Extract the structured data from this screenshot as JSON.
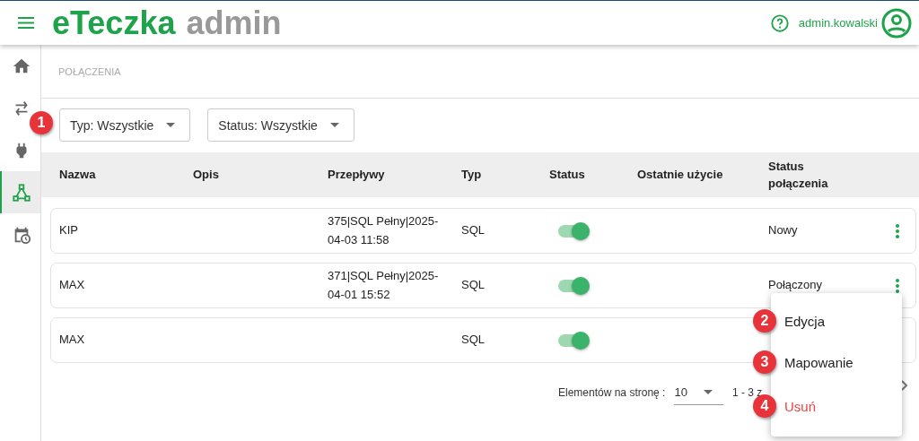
{
  "header": {
    "logo_primary": "eTeczka",
    "logo_secondary": "admin",
    "username": "admin.kowalski"
  },
  "sidebar": [
    {
      "selected": false
    },
    {
      "selected": false
    },
    {
      "selected": false
    },
    {
      "selected": true
    },
    {
      "selected": false
    }
  ],
  "breadcrumb": "POŁĄCZENIA",
  "filters": [
    {
      "label": "Typ: Wszystkie",
      "badge": "1"
    },
    {
      "label": "Status: Wszystkie"
    }
  ],
  "table": {
    "columns": [
      "Nazwa",
      "Opis",
      "Przepływy",
      "Typ",
      "Status",
      "Ostatnie użycie",
      "Status połączenia"
    ],
    "rows": [
      {
        "name": "KIP",
        "flows": "375|SQL Pełny|2025-04-03 11:58",
        "type": "SQL",
        "enabled": true,
        "connection_status": "Nowy",
        "actions": true
      },
      {
        "name": "MAX",
        "flows": "371|SQL Pełny|2025-04-01 15:52",
        "type": "SQL",
        "enabled": true,
        "connection_status": "Połączony",
        "actions": true
      },
      {
        "name": "MAX",
        "type": "SQL",
        "enabled": true
      }
    ]
  },
  "pagination": {
    "label": "Elementów na stronę :",
    "page_size": "10",
    "range": "1 - 3 z"
  },
  "context_menu": [
    {
      "label": "Edycja",
      "kind": "normal",
      "badge": "2"
    },
    {
      "label": "Mapowanie",
      "kind": "normal",
      "badge": "3"
    },
    {
      "label": "Usuń",
      "kind": "danger",
      "badge": "4"
    }
  ]
}
